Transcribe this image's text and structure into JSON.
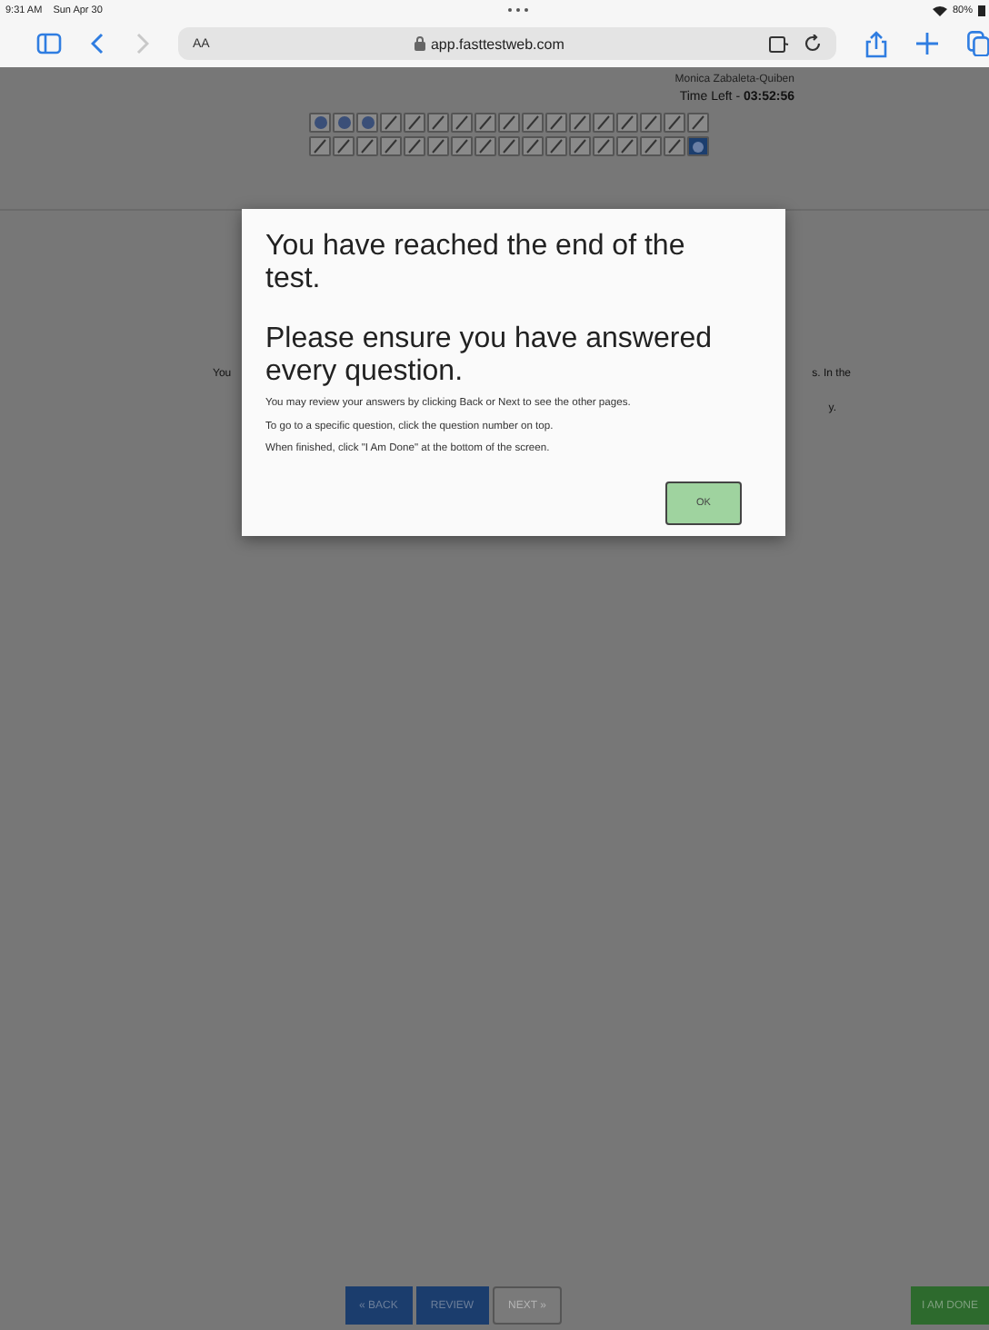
{
  "status_bar": {
    "time": "9:31 AM",
    "date": "Sun Apr 30",
    "battery": "80%"
  },
  "browser": {
    "text_size": "AA",
    "address": "app.fasttestweb.com",
    "back_enabled": true,
    "forward_enabled": false
  },
  "header": {
    "student": "Monica Zabaleta-Quiben",
    "time_left_label": "Time Left - ",
    "time_left": "03:52:56"
  },
  "questions": [
    {
      "kind": "answered"
    },
    {
      "kind": "answered"
    },
    {
      "kind": "answered"
    },
    {
      "kind": "open"
    },
    {
      "kind": "open"
    },
    {
      "kind": "open"
    },
    {
      "kind": "open"
    },
    {
      "kind": "open"
    },
    {
      "kind": "open"
    },
    {
      "kind": "open"
    },
    {
      "kind": "open"
    },
    {
      "kind": "open"
    },
    {
      "kind": "open"
    },
    {
      "kind": "open"
    },
    {
      "kind": "open"
    },
    {
      "kind": "open"
    },
    {
      "kind": "open"
    },
    {
      "kind": "open"
    },
    {
      "kind": "open"
    },
    {
      "kind": "open"
    },
    {
      "kind": "open"
    },
    {
      "kind": "open"
    },
    {
      "kind": "open"
    },
    {
      "kind": "open"
    },
    {
      "kind": "open"
    },
    {
      "kind": "open"
    },
    {
      "kind": "open"
    },
    {
      "kind": "open"
    },
    {
      "kind": "open"
    },
    {
      "kind": "open"
    },
    {
      "kind": "open"
    },
    {
      "kind": "open"
    },
    {
      "kind": "open"
    },
    {
      "kind": "current"
    }
  ],
  "background_text": {
    "left": "You",
    "right_1": "s. In the",
    "right_2": "y."
  },
  "dialog": {
    "title": "You have reached the end of the test.",
    "subtitle": "Please ensure you have answered every question.",
    "lines": [
      "You may review your answers by clicking Back or Next to see the other pages.",
      "To go to a specific question, click the question number on top.",
      "When finished, click \"I Am Done\" at the bottom of the screen."
    ],
    "ok": "OK"
  },
  "footer": {
    "back": "« BACK",
    "review": "REVIEW",
    "next": "NEXT »",
    "next_disabled": true,
    "done": "I AM DONE"
  }
}
